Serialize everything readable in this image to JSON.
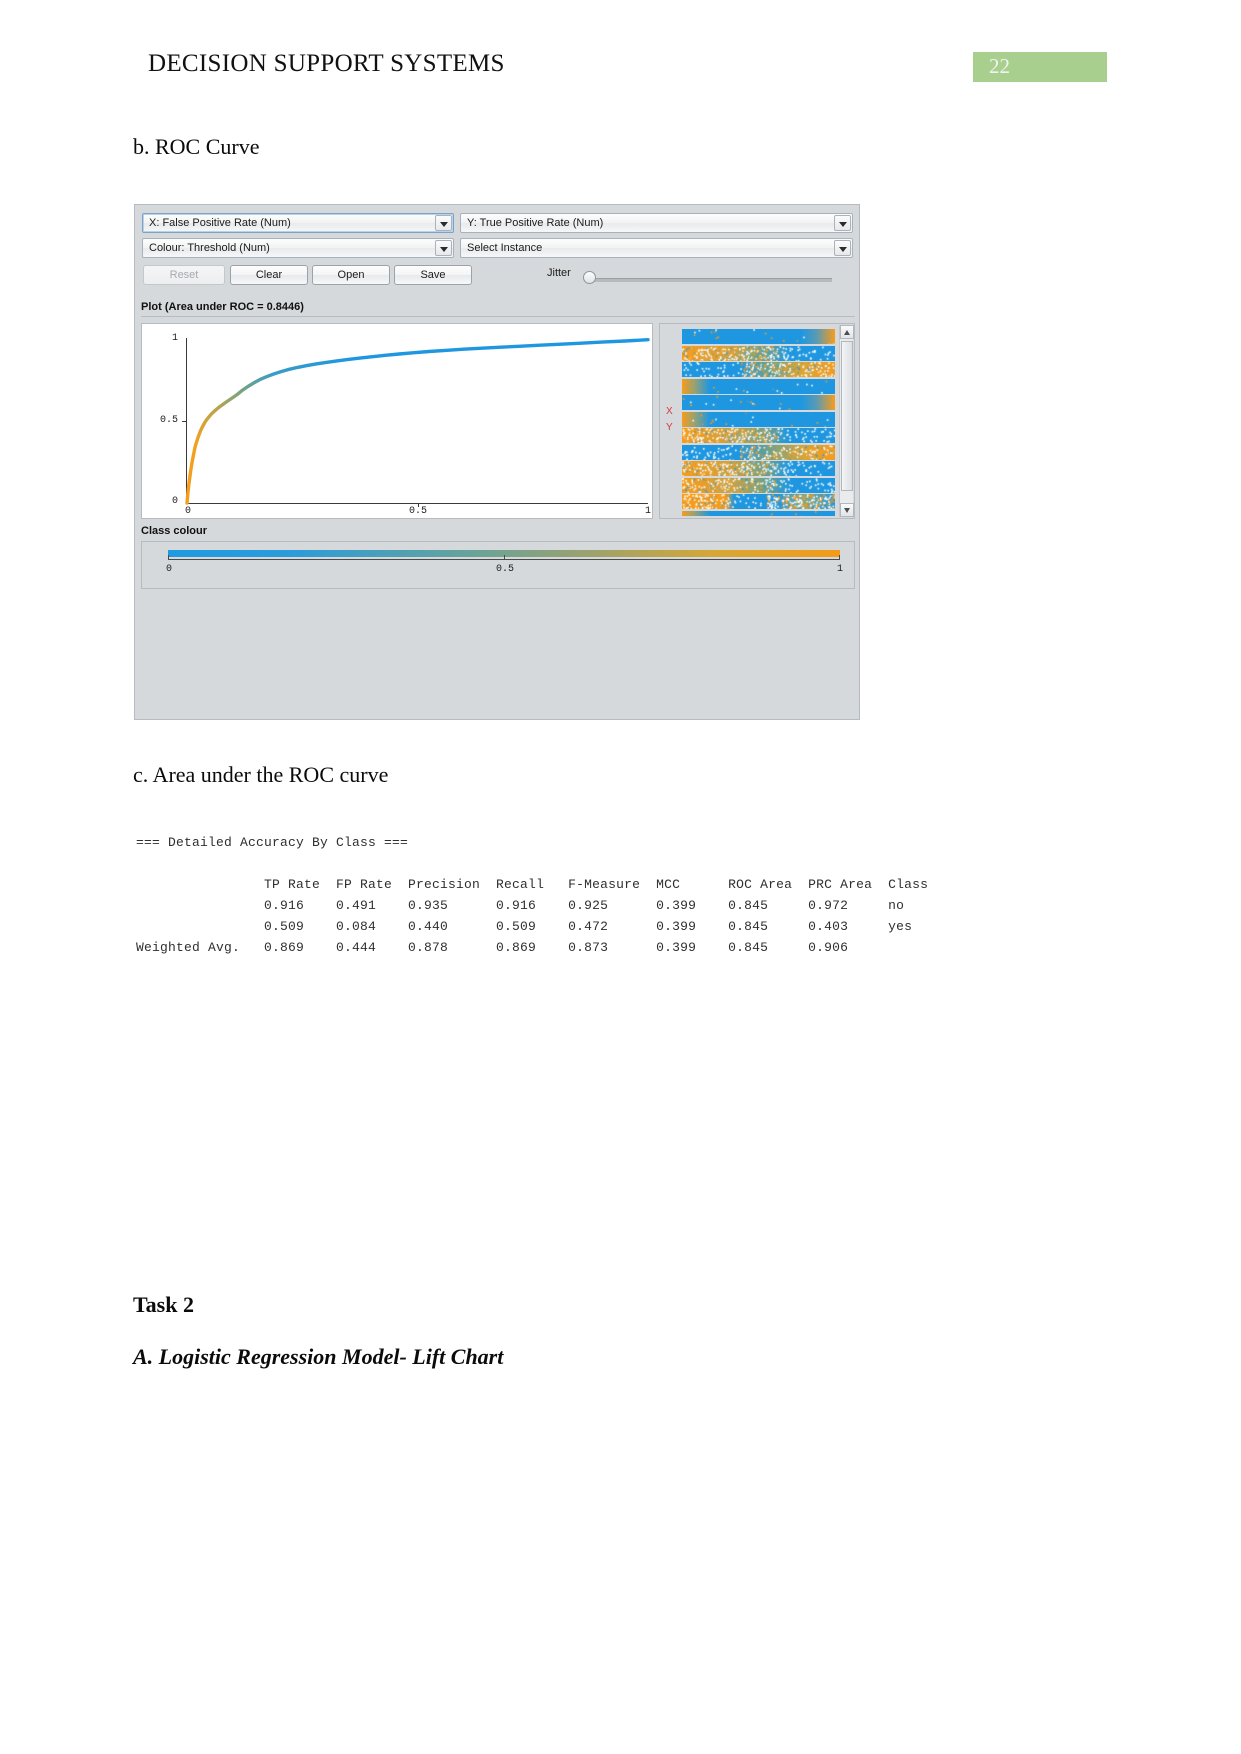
{
  "header": {
    "document_title": "DECISION SUPPORT SYSTEMS",
    "page_number": "22"
  },
  "headings": {
    "section_b": "b. ROC Curve",
    "section_c": "c. Area under the ROC curve",
    "task2": "Task 2",
    "task2_a": "A. Logistic Regression Model- Lift Chart"
  },
  "weka": {
    "combo_x": "X: False Positive Rate (Num)",
    "combo_y": "Y: True Positive Rate (Num)",
    "combo_colour": "Colour: Threshold (Num)",
    "combo_instance": "Select Instance",
    "buttons": {
      "reset": "Reset",
      "clear": "Clear",
      "open": "Open",
      "save": "Save"
    },
    "jitter_label": "Jitter",
    "plot_title": "Plot (Area under ROC = 0.8446)",
    "axis_marks": {
      "x": "X",
      "y": "Y"
    },
    "class_colour_label": "Class colour",
    "class_colour_ticks": [
      "0",
      "0.5",
      "1"
    ],
    "colors": {
      "low": "#1f9ae0",
      "high": "#f49b18",
      "mark": "#d23b3b",
      "panel": "#d6d9dc"
    }
  },
  "chart_data": {
    "type": "line",
    "title": "Plot (Area under ROC = 0.8446)",
    "xlabel": "False Positive Rate (Num)",
    "ylabel": "True Positive Rate (Num)",
    "xlim": [
      0,
      1
    ],
    "ylim": [
      0,
      1
    ],
    "xticks": [
      "0",
      "0.5",
      "1"
    ],
    "yticks": [
      "0",
      "0.5",
      "1"
    ],
    "grid": false,
    "legend": "none",
    "colour_attribute": "Threshold (Num)",
    "area_under_roc": 0.8446,
    "series": [
      {
        "name": "ROC Curve",
        "x": [
          0.0,
          0.002,
          0.004,
          0.006,
          0.008,
          0.01,
          0.012,
          0.014,
          0.016,
          0.018,
          0.021,
          0.024,
          0.027,
          0.03,
          0.034,
          0.038,
          0.042,
          0.047,
          0.052,
          0.058,
          0.064,
          0.07,
          0.077,
          0.084,
          0.092,
          0.1,
          0.11,
          0.12,
          0.132,
          0.145,
          0.158,
          0.172,
          0.188,
          0.205,
          0.222,
          0.24,
          0.26,
          0.28,
          0.302,
          0.325,
          0.35,
          0.375,
          0.4,
          0.43,
          0.46,
          0.49,
          0.525,
          0.56,
          0.6,
          0.64,
          0.68,
          0.72,
          0.76,
          0.8,
          0.85,
          0.9,
          0.95,
          1.0
        ],
        "y": [
          0.0,
          0.06,
          0.11,
          0.155,
          0.195,
          0.23,
          0.262,
          0.292,
          0.32,
          0.345,
          0.372,
          0.398,
          0.42,
          0.442,
          0.465,
          0.485,
          0.503,
          0.52,
          0.537,
          0.553,
          0.568,
          0.582,
          0.596,
          0.61,
          0.625,
          0.64,
          0.66,
          0.683,
          0.706,
          0.728,
          0.748,
          0.765,
          0.782,
          0.797,
          0.81,
          0.822,
          0.833,
          0.843,
          0.852,
          0.861,
          0.87,
          0.878,
          0.886,
          0.895,
          0.903,
          0.91,
          0.918,
          0.925,
          0.932,
          0.938,
          0.944,
          0.95,
          0.956,
          0.961,
          0.968,
          0.975,
          0.982,
          0.99
        ]
      }
    ]
  },
  "accuracy_output": {
    "section_title": "=== Detailed Accuracy By Class ===",
    "columns": [
      "TP Rate",
      "FP Rate",
      "Precision",
      "Recall",
      "F-Measure",
      "MCC",
      "ROC Area",
      "PRC Area",
      "Class"
    ],
    "rows": [
      {
        "label": "",
        "tp_rate": "0.916",
        "fp_rate": "0.491",
        "precision": "0.935",
        "recall": "0.916",
        "f_measure": "0.925",
        "mcc": "0.399",
        "roc_area": "0.845",
        "prc_area": "0.972",
        "class": "no"
      },
      {
        "label": "",
        "tp_rate": "0.509",
        "fp_rate": "0.084",
        "precision": "0.440",
        "recall": "0.509",
        "f_measure": "0.472",
        "mcc": "0.399",
        "roc_area": "0.845",
        "prc_area": "0.403",
        "class": "yes"
      },
      {
        "label": "Weighted Avg.",
        "tp_rate": "0.869",
        "fp_rate": "0.444",
        "precision": "0.878",
        "recall": "0.869",
        "f_measure": "0.873",
        "mcc": "0.399",
        "roc_area": "0.845",
        "prc_area": "0.906",
        "class": ""
      }
    ],
    "rendered_text": "=== Detailed Accuracy By Class ===\n\n                TP Rate  FP Rate  Precision  Recall   F-Measure  MCC      ROC Area  PRC Area  Class\n                0.916    0.491    0.935      0.916    0.925      0.399    0.845     0.972     no\n                0.509    0.084    0.440      0.509    0.472      0.399    0.845     0.403     yes\nWeighted Avg.   0.869    0.444    0.878      0.869    0.873      0.399    0.845     0.906"
  }
}
